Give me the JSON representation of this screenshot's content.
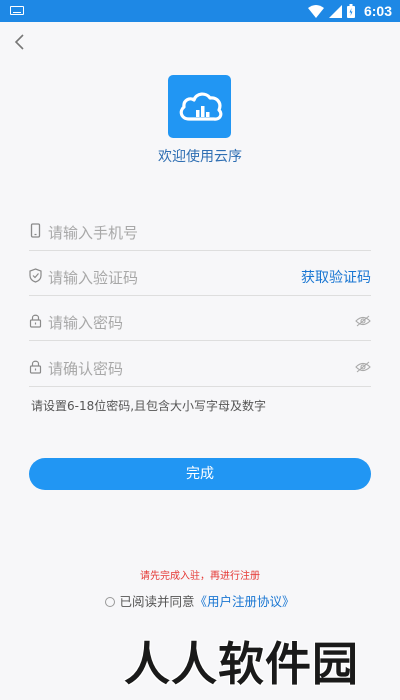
{
  "status_bar": {
    "time": "6:03",
    "icons": [
      "keyboard-icon",
      "wifi-icon",
      "signal-icon",
      "battery-icon"
    ],
    "bg_color": "#1e88e5"
  },
  "header": {
    "back_icon": "chevron-left-icon"
  },
  "brand": {
    "logo_icon": "cloud-chart-icon",
    "logo_color": "#2196f3",
    "welcome": "欢迎使用云序"
  },
  "form": {
    "phone": {
      "placeholder": "请输入手机号",
      "icon": "phone-icon"
    },
    "code": {
      "placeholder": "请输入验证码",
      "icon": "shield-icon",
      "get_code_label": "获取验证码"
    },
    "password": {
      "placeholder": "请输入密码",
      "icon": "lock-icon",
      "toggle_icon": "eye-off-icon"
    },
    "confirm_password": {
      "placeholder": "请确认密码",
      "icon": "lock-icon",
      "toggle_icon": "eye-off-icon"
    },
    "hint": "请设置6-18位密码,且包含大小写字母及数字"
  },
  "actions": {
    "submit_label": "完成",
    "accent_color": "#2196f3"
  },
  "footer": {
    "warning": "请先完成入驻，再进行注册",
    "agree_prefix": "已阅读并同意",
    "agree_link": "《用户注册协议》",
    "warning_color": "#e53935"
  },
  "watermark": "人人软件园"
}
